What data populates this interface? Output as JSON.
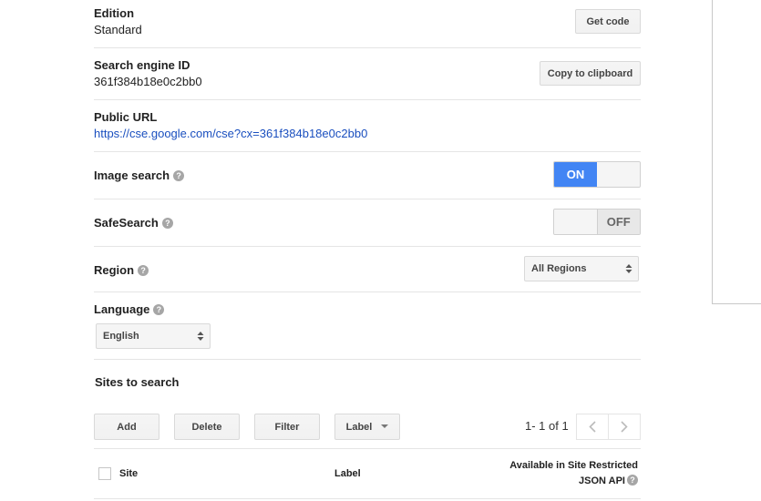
{
  "edition": {
    "label": "Edition",
    "value": "Standard",
    "button": "Get code"
  },
  "engine_id": {
    "label": "Search engine ID",
    "value": "361f384b18e0c2bb0",
    "button": "Copy to clipboard"
  },
  "public_url": {
    "label": "Public URL",
    "value": "https://cse.google.com/cse?cx=361f384b18e0c2bb0"
  },
  "image_search": {
    "label": "Image search",
    "state": "ON"
  },
  "safesearch": {
    "label": "SafeSearch",
    "state": "OFF"
  },
  "region": {
    "label": "Region",
    "selected": "All Regions"
  },
  "language": {
    "label": "Language",
    "selected": "English"
  },
  "sites": {
    "title": "Sites to search",
    "toolbar": {
      "add": "Add",
      "delete": "Delete",
      "filter": "Filter",
      "label": "Label"
    },
    "pagination": "1- 1 of 1",
    "columns": {
      "site": "Site",
      "label": "Label",
      "available_line1": "Available in Site Restricted",
      "available_line2": "JSON API"
    }
  },
  "help_glyph": "?",
  "colors": {
    "accent": "#4285f4",
    "link": "#1a4fbf"
  }
}
